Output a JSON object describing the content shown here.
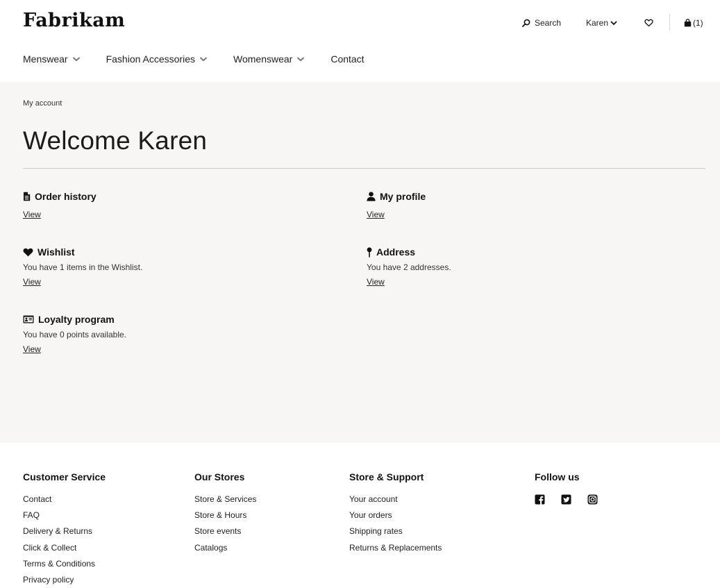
{
  "brand": {
    "name": "Fabrikam"
  },
  "header": {
    "search_label": "Search",
    "user_label": "Karen",
    "cart_count": "(1)"
  },
  "nav": {
    "items": [
      {
        "label": "Menswear"
      },
      {
        "label": "Fashion Accessories"
      },
      {
        "label": "Womenswear"
      },
      {
        "label": "Contact"
      }
    ]
  },
  "main": {
    "breadcrumb": "My account",
    "title": "Welcome Karen",
    "cards": {
      "order_history": {
        "title": "Order history",
        "text": "",
        "link": "View",
        "icon": "document-icon"
      },
      "my_profile": {
        "title": "My profile",
        "text": "",
        "link": "View",
        "icon": "user-icon"
      },
      "wishlist": {
        "title": "Wishlist",
        "text": "You have 1 items in the Wishlist.",
        "link": "View",
        "icon": "heart-icon"
      },
      "address": {
        "title": "Address",
        "text": "You have 2 addresses.",
        "link": "View",
        "icon": "pin-icon"
      },
      "loyalty": {
        "title": "Loyalty program",
        "text": "You have 0 points available.",
        "link": "View",
        "icon": "id-card-icon"
      }
    }
  },
  "footer": {
    "customer_service": {
      "title": "Customer Service",
      "links": [
        "Contact",
        "FAQ",
        "Delivery & Returns",
        "Click & Collect",
        "Terms & Conditions",
        "Privacy policy"
      ]
    },
    "our_stores": {
      "title": "Our Stores",
      "links": [
        "Store & Services",
        "Store & Hours",
        "Store events",
        "Catalogs"
      ]
    },
    "store_support": {
      "title": "Store & Support",
      "links": [
        "Your account",
        "Your orders",
        "Shipping rates",
        "Returns & Replacements"
      ]
    },
    "follow_us": {
      "title": "Follow us",
      "icons": [
        "facebook-icon",
        "twitter-icon",
        "instagram-icon"
      ]
    }
  }
}
